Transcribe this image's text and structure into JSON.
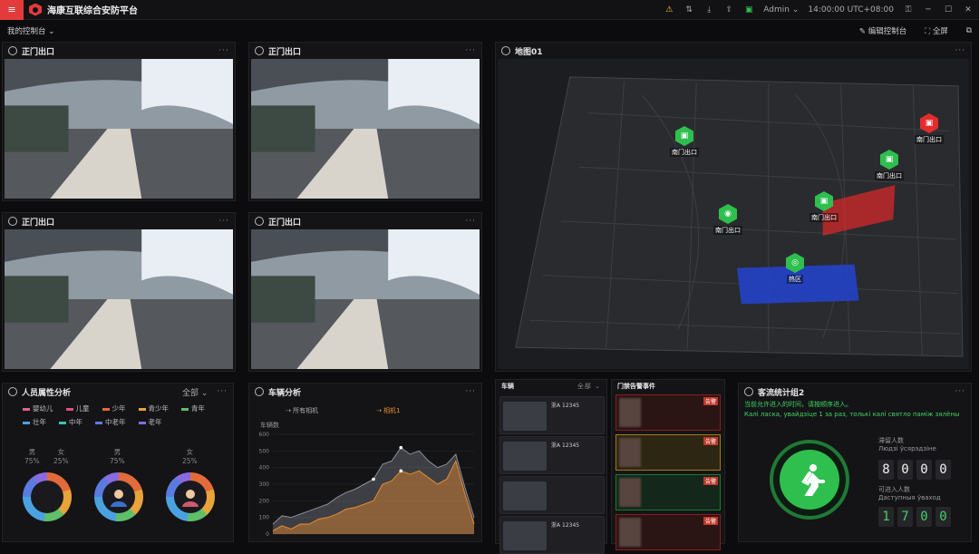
{
  "app": {
    "title": "海康互联综合安防平台",
    "user": "Admin",
    "time": "14:00:00 UTC+08:00"
  },
  "toolbar": {
    "console": "我的控制台",
    "edit": "编辑控制台",
    "fullscreen": "全屏"
  },
  "cams": [
    {
      "title": "正门出口"
    },
    {
      "title": "正门出口"
    },
    {
      "title": "正门出口"
    },
    {
      "title": "正门出口"
    }
  ],
  "map": {
    "title": "地图01",
    "pins": [
      "南门出口",
      "南门出口",
      "南门出口",
      "南门出口",
      "南门出口",
      "热区"
    ]
  },
  "person": {
    "title": "人员属性分析",
    "filter": "全部",
    "legend": [
      {
        "name": "婴幼儿",
        "color": "#e0628a"
      },
      {
        "name": "儿童",
        "color": "#e04f7a"
      },
      {
        "name": "少年",
        "color": "#e36a3a"
      },
      {
        "name": "青少年",
        "color": "#e8a33a"
      },
      {
        "name": "青年",
        "color": "#5fbf6a"
      },
      {
        "name": "壮年",
        "color": "#4aa3e0"
      },
      {
        "name": "中年",
        "color": "#3fbfb0"
      },
      {
        "name": "中老年",
        "color": "#5a7be0"
      },
      {
        "name": "老年",
        "color": "#8a6ae0"
      }
    ],
    "gender": [
      {
        "label": "男",
        "pct": "75%"
      },
      {
        "label": "女",
        "pct": "25%"
      }
    ],
    "g2": {
      "label": "男",
      "pct": "75%"
    },
    "g3": {
      "label": "女",
      "pct": "25%"
    }
  },
  "vehicle": {
    "title": "车辆分析",
    "series_all": "所有相机",
    "series_cam": "相机1",
    "ylabel": "车辆数",
    "chart_data": {
      "type": "area",
      "ylabel": "车辆数",
      "ylim": [
        0,
        600
      ],
      "yticks": [
        0,
        100,
        200,
        300,
        400,
        500,
        600
      ],
      "series": [
        {
          "name": "所有相机",
          "color": "#8a8f99",
          "values": [
            60,
            110,
            100,
            120,
            140,
            160,
            180,
            220,
            250,
            270,
            300,
            330,
            420,
            440,
            520,
            480,
            500,
            440,
            400,
            420,
            480,
            280,
            100
          ]
        },
        {
          "name": "相机1",
          "color": "#e88a2e",
          "values": [
            20,
            50,
            30,
            60,
            60,
            90,
            100,
            120,
            150,
            160,
            180,
            200,
            300,
            320,
            380,
            360,
            380,
            340,
            300,
            330,
            440,
            240,
            60
          ]
        }
      ]
    }
  },
  "listpanel": {
    "title": "车辆",
    "filter": "全部",
    "plate": "浙A 12345"
  },
  "alarms": {
    "title": "门禁告警事件",
    "tag": "告警"
  },
  "flow": {
    "title": "客流统计组2",
    "msg1": "当前允许进入的时间，请按顺序进入。",
    "msg2": "Калі ласка, увайдзіце 1 за раз, толькі калі святло паміж зялёны",
    "in_label": "滞留人数",
    "in_sub": "Людзі ўсярэдзіне",
    "in_digits": [
      "8",
      "0",
      "0",
      "0"
    ],
    "avail_label": "可进入人数",
    "avail_sub": "Даступныя ўваход",
    "avail_digits": [
      "1",
      "7",
      "0",
      "0"
    ]
  }
}
